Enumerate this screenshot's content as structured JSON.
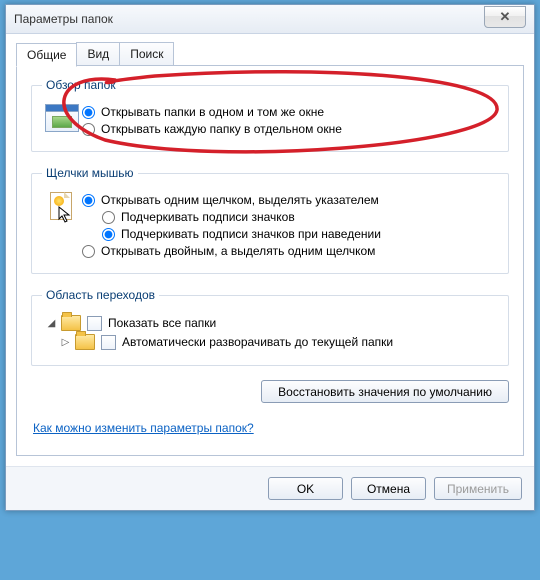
{
  "window": {
    "title": "Параметры папок"
  },
  "tabs": {
    "general": "Общие",
    "view": "Вид",
    "search": "Поиск"
  },
  "browse": {
    "legend": "Обзор папок",
    "same_window": "Открывать папки в одном и том же окне",
    "own_window": "Открывать каждую папку в отдельном окне"
  },
  "click": {
    "legend": "Щелчки мышью",
    "single": "Открывать одним щелчком, выделять указателем",
    "underline_always": "Подчеркивать подписи значков",
    "underline_hover": "Подчеркивать подписи значков при наведении",
    "double": "Открывать двойным, а выделять одним щелчком"
  },
  "navpane": {
    "legend": "Область переходов",
    "show_all": "Показать все папки",
    "auto_expand": "Автоматически разворачивать до текущей папки"
  },
  "buttons": {
    "restore": "Восстановить значения по умолчанию",
    "ok": "OK",
    "cancel": "Отмена",
    "apply": "Применить"
  },
  "help_link": "Как можно изменить параметры папок?",
  "annotation_color": "#d4202a"
}
